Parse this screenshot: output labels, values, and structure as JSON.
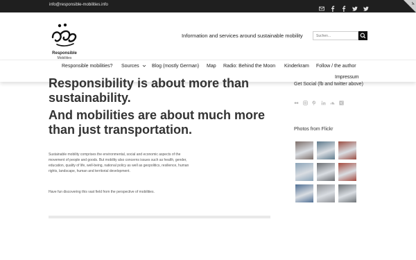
{
  "topbar": {
    "email": "info@responsible-mobilities.info",
    "social_icons": [
      "mail-icon",
      "facebook-icon",
      "facebook-icon",
      "twitter-icon",
      "twitter-icon"
    ]
  },
  "header": {
    "brand_line1": "Responsible",
    "brand_line2": "Mobilities",
    "tagline": "Information and services around sustainable mobility",
    "search_placeholder": "Suchen..."
  },
  "nav": {
    "items": [
      "Responsible mobilities?",
      "Sources",
      "Blog (mostly German)",
      "Map",
      "Radio: Behind the Moon",
      "Kinderkram",
      "Follow / the author"
    ],
    "sub_item": "Impressum"
  },
  "main": {
    "headline1": "Responsibility is about more than sustainability.",
    "headline2": "And mobilities are about much more than just transportation.",
    "paragraph1": "Sustainable mobility comprises the environmental, social and economic aspects of the movement of people and goods. But mobility also concerns issues such as health, gender, education, quality of life, well-being, national policy as well as geopolitics, resilience, human rights, landscape, human and territorial development.",
    "paragraph2": "Have fun discovering this vast field from the perspective of mobilities."
  },
  "sidebar": {
    "social_title": "Get Social (fb and twitter above)",
    "social_icons": [
      "flickr-icon",
      "instagram-icon",
      "pinterest-icon",
      "linkedin-icon",
      "soundcloud-icon",
      "xing-icon"
    ],
    "flickr_title": "Photos from Flickr",
    "photos": [
      "#7d6e69",
      "#5e7a8c",
      "#9c4f44",
      "#8aa3b8",
      "#6b6e72",
      "#a54a3e",
      "#4f6f94",
      "#8c8f94",
      "#6f7478"
    ]
  },
  "colors": {
    "topbar": "#1f1f1f",
    "ribbon": "#cfcfcf",
    "text": "#333333"
  }
}
